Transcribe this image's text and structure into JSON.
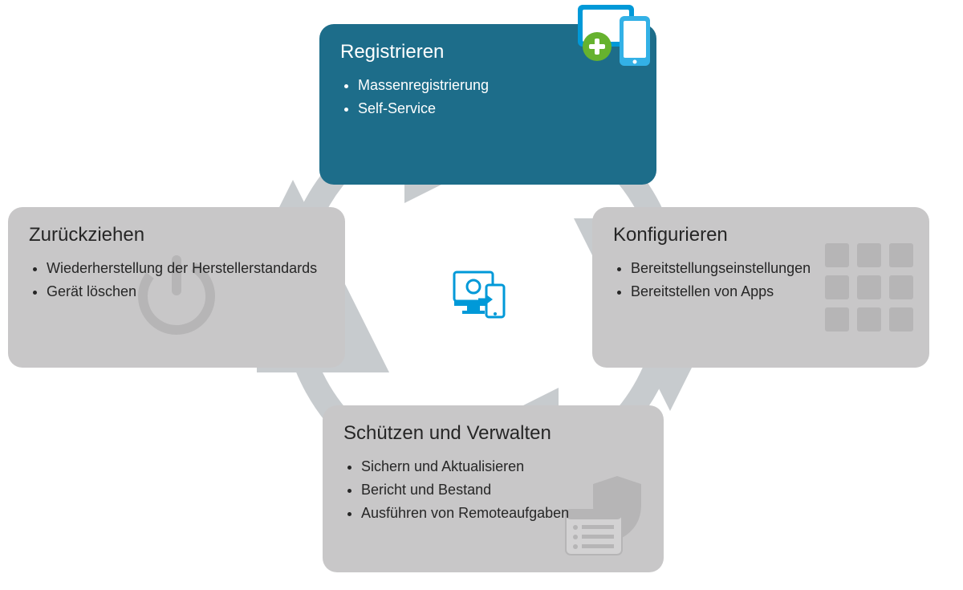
{
  "cards": {
    "top": {
      "title": "Registrieren",
      "items": [
        "Massenregistrierung",
        "Self-Service"
      ]
    },
    "right": {
      "title": "Konfigurieren",
      "items": [
        "Bereitstellungseinstellungen",
        "Bereitstellen von Apps"
      ]
    },
    "bottom": {
      "title": "Schützen und Verwalten",
      "items": [
        "Sichern und Aktualisieren",
        "Bericht und Bestand",
        "Ausführen von Remoteaufgaben"
      ]
    },
    "left": {
      "title": "Zurückziehen",
      "items": [
        "Wiederherstellung der Herstellerstandards",
        "Gerät löschen"
      ]
    }
  },
  "colors": {
    "blue_card": "#1d6d8a",
    "gray_card": "#c8c7c8",
    "ring": "#c7cbce",
    "accent_blue": "#0099d8",
    "accent_green": "#66b22e"
  }
}
